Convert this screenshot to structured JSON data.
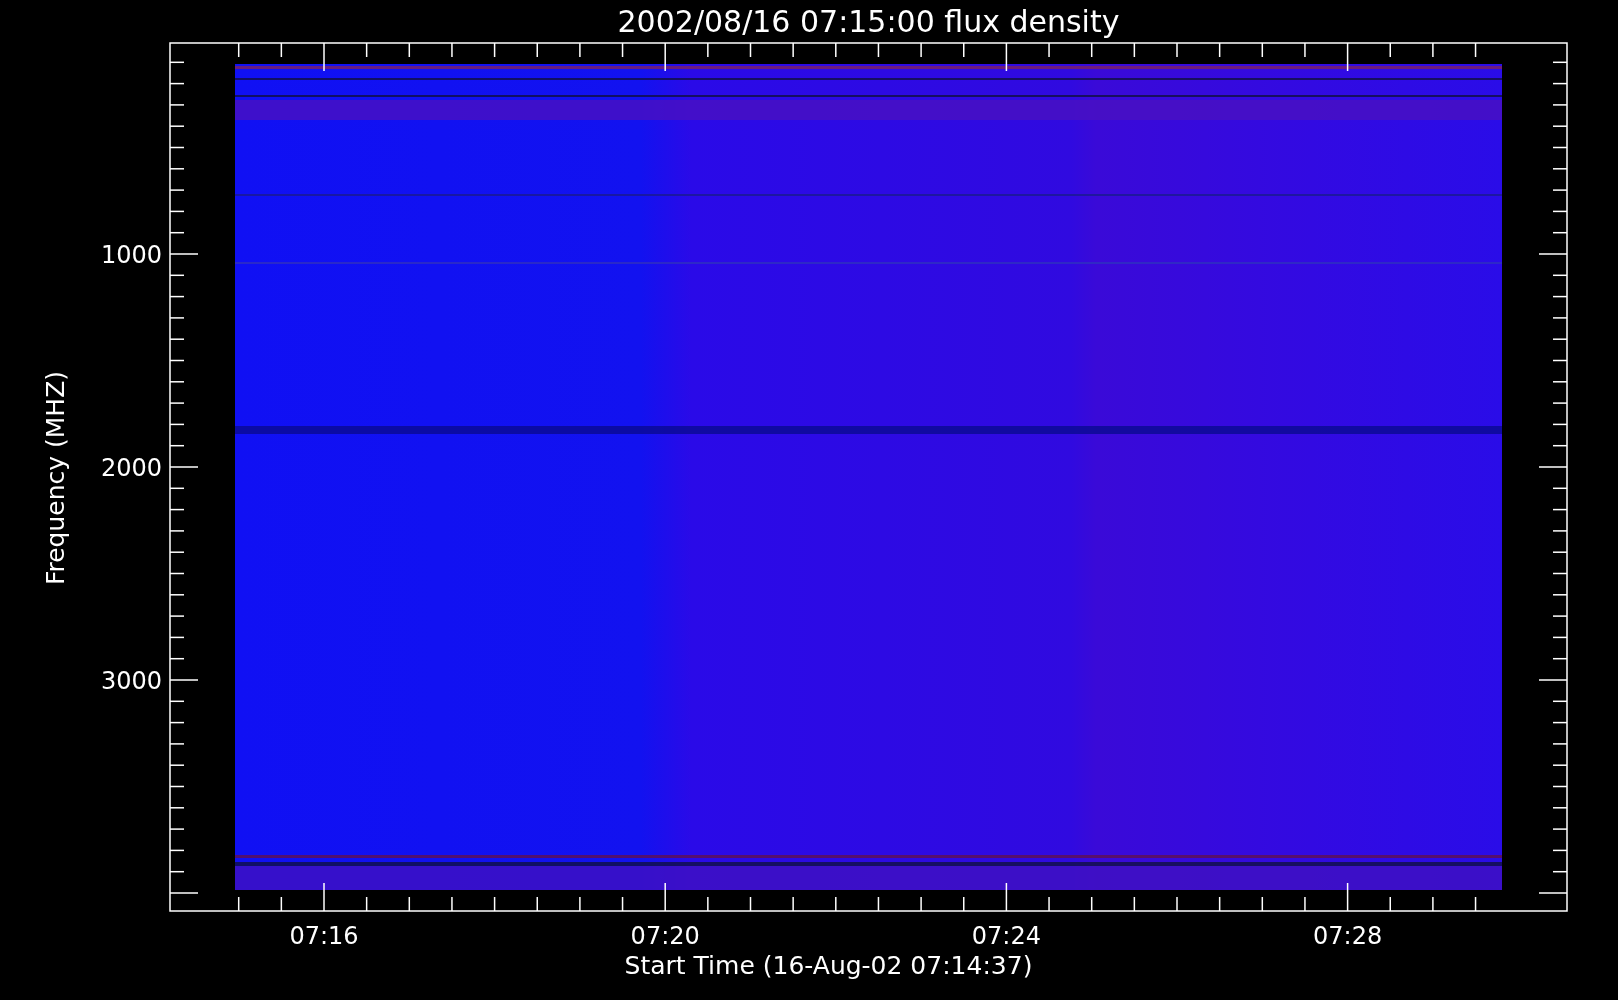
{
  "title": "2002/08/16 07:15:00 flux density",
  "y_axis": {
    "label": "Frequency (MHZ)",
    "tick_labels": [
      "1000",
      "2000",
      "3000"
    ]
  },
  "x_axis": {
    "label": "Start Time (16-Aug-02 07:14:37)",
    "tick_labels": [
      "07:16",
      "07:20",
      "07:24",
      "07:28"
    ]
  }
}
